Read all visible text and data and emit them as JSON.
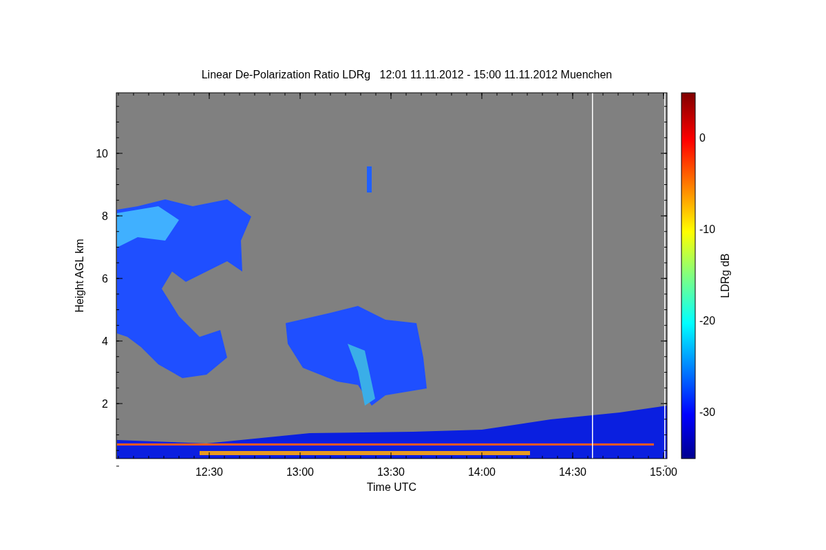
{
  "plot": {
    "title": "Linear De-Polarization Ratio LDRg   12:01 11.11.2012 - 15:00 11.11.2012 Muenchen",
    "ylabel": "Height AGL km",
    "xlabel": "Time UTC",
    "yticks": [
      "10",
      "8",
      "6",
      "4",
      "2"
    ],
    "xticks": [
      "12:30",
      "13:00",
      "13:30",
      "14:00",
      "14:30",
      "15:00"
    ]
  },
  "colorbar": {
    "label": "LDRg dB",
    "ticks": [
      "0",
      "-10",
      "-20",
      "-30"
    ]
  }
}
